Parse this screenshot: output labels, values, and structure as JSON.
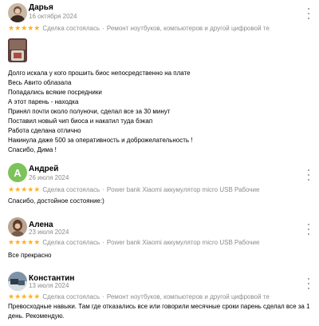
{
  "colors": {
    "star": "#ffb021",
    "muted": "#8c8c8c",
    "avatar_green": "#7cc35a"
  },
  "icons": {
    "stars": "star-icon",
    "menu": "more-vertical-icon"
  },
  "reviews": [
    {
      "author": "Дарья",
      "date": "16 октября 2024",
      "rating": 5,
      "stars": "★★★★★",
      "deal": "Сделка состоялась",
      "separator": "·",
      "item": "Ремонт ноутбуков, компьютеров и другой цифровой те",
      "lines": [
        "Долго искала у кого прошить биос непосредственно на плате",
        "Весь Авито облазала",
        "Попадались всякие посредники",
        "А этот парень - находка",
        "Принял почти около полуночи, сделал все за 30 минут",
        "Поставил новый чип биоса и накатил туда бэкап",
        "Работа сделана отлично",
        "Накинула даже 500 за оперативность и доброжелательность !",
        "Спасибо, Дима !"
      ]
    },
    {
      "author": "Андрей",
      "avatar_letter": "А",
      "date": "26 июля 2024",
      "rating": 5,
      "stars": "★★★★★",
      "deal": "Сделка состоялась",
      "separator": "·",
      "item": "Power bank Xiaomi аккумулятор micro USB Рабочие",
      "lines": [
        "Спасибо, достойное состояние:)"
      ]
    },
    {
      "author": "Алена",
      "date": "23 июля 2024",
      "rating": 5,
      "stars": "★★★★★",
      "deal": "Сделка состоялась",
      "separator": "·",
      "item": "Power bank Xiaomi аккумулятор micro USB Рабочие",
      "lines": [
        "Все прекрасно"
      ]
    },
    {
      "author": "Константин",
      "date": "13 июля 2024",
      "rating": 5,
      "stars": "★★★★★",
      "deal": "Сделка состоялась",
      "separator": "·",
      "item": "Ремонт ноутбуков, компьютеров и другой цифровой те",
      "text": "Превосходные навыки. Там где отказались все или говорили месячные сроки парень сделал все за 1 день. Рекомендую."
    }
  ]
}
